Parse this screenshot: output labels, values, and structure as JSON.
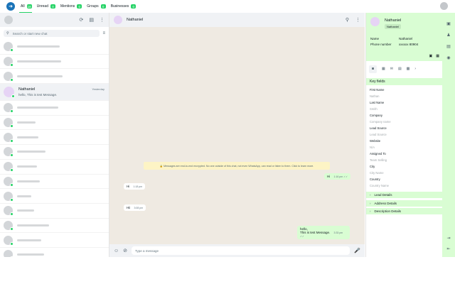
{
  "topbar": {
    "tabs": [
      {
        "label": "All",
        "count": "18"
      },
      {
        "label": "Unread",
        "count": "0"
      },
      {
        "label": "Mentions",
        "count": "0"
      },
      {
        "label": "Groups",
        "count": "0"
      },
      {
        "label": "Businesses",
        "count": "0"
      }
    ]
  },
  "left": {
    "search_placeholder": "Search or start new chat",
    "selected_chat": {
      "name": "Nathaniel",
      "last_message": "hello, This is test Message.",
      "time": "Yesterday"
    }
  },
  "chat": {
    "contact_name": "Nathaniel",
    "encryption_notice": "🔒 Messages are end-to-end encrypted. No one outside of this chat, not even WhatsApp, can read or listen to them. Click to learn more.",
    "messages": [
      {
        "dir": "out",
        "text": "Hi",
        "time": "1:16 pm ✓✓"
      },
      {
        "dir": "in",
        "text": "Hi",
        "time": "1:18 pm"
      },
      {
        "dir": "in",
        "text": "Hii",
        "time": "3:08 pm"
      },
      {
        "dir": "out",
        "text": "hello,",
        "text2": "This is test Message.",
        "time": "3:33 pm ✓✓"
      }
    ],
    "input_placeholder": "Type a message"
  },
  "crm": {
    "name": "Nathaniel",
    "tag": "Nathaniel",
    "name_label": "Name",
    "name_value": "Nathaniel",
    "phone_label": "Phone number",
    "phone_value": "xxxxxx 80904",
    "key_fields_title": "Key fields",
    "fields": [
      {
        "label": "First Name",
        "value": "Nathan"
      },
      {
        "label": "Last Name",
        "value": "Smith"
      },
      {
        "label": "Company",
        "value": "Company name"
      },
      {
        "label": "Lead Source",
        "value": "Lead Source"
      },
      {
        "label": "Website",
        "value": "N/A"
      },
      {
        "label": "Assigned To",
        "value": "Team Selling"
      },
      {
        "label": "City",
        "value": "City Name"
      },
      {
        "label": "Country",
        "value": "Country Name"
      }
    ],
    "sections": [
      "Lead Details",
      "Address Details",
      "Description Details"
    ]
  }
}
